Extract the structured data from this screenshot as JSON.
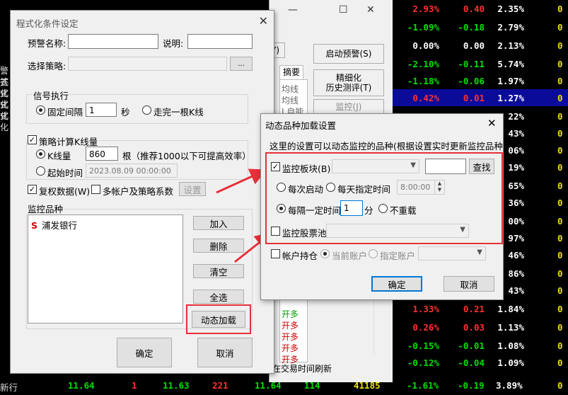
{
  "bg_rows": [
    {
      "c1": "2.93%",
      "c1c": "red",
      "c2": "0.40",
      "c2c": "red",
      "c3": "2.35%",
      "c4": "0"
    },
    {
      "c1": "-1.09%",
      "c1c": "green",
      "c2": "-0.18",
      "c2c": "green",
      "c3": "2.79%",
      "c4": "0"
    },
    {
      "c1": "0.00%",
      "c1c": "white",
      "c2": "0.00",
      "c2c": "white",
      "c3": "2.13%",
      "c4": "0"
    },
    {
      "c1": "-2.10%",
      "c1c": "green",
      "c2": "-0.11",
      "c2c": "green",
      "c3": "5.74%",
      "c4": "0"
    },
    {
      "c1": "-1.18%",
      "c1c": "green",
      "c2": "-0.06",
      "c2c": "green",
      "c3": "1.97%",
      "c4": "0"
    },
    {
      "c1": "0.42%",
      "c1c": "red",
      "c2": "0.01",
      "c2c": "red",
      "c3": "1.27%",
      "c4": "0"
    },
    {
      "c3": "22%",
      "c4": "0"
    },
    {
      "c3": "43%",
      "c4": "0"
    },
    {
      "c3": "06%",
      "c4": "0"
    },
    {
      "c3": "19%",
      "c4": "0"
    },
    {
      "c3": "65%",
      "c4": "0"
    },
    {
      "c3": "36%",
      "c4": "0"
    },
    {
      "c3": "00%",
      "c4": "0"
    },
    {
      "c3": "97%",
      "c4": "0"
    },
    {
      "c3": "46%",
      "c4": "0"
    },
    {
      "c3": "86%",
      "c4": "0"
    },
    {
      "c3": "43%",
      "c4": "0"
    },
    {
      "c1": "1.33%",
      "c1c": "red",
      "c2": "0.21",
      "c2c": "red",
      "c3": "1.84%",
      "c4": "0"
    },
    {
      "c1": "0.26%",
      "c1c": "red",
      "c2": "0.03",
      "c2c": "red",
      "c3": "1.13%",
      "c4": "0"
    },
    {
      "c1": "-0.15%",
      "c1c": "green",
      "c2": "-0.01",
      "c2c": "green",
      "c3": "1.08%",
      "c4": "0"
    },
    {
      "c1": "-0.12%",
      "c1c": "green",
      "c2": "-0.04",
      "c2c": "green",
      "c3": "1.09%",
      "c4": "0"
    }
  ],
  "bottom_bar": {
    "v1": "11.64",
    "v2": "1",
    "v3": "11.63",
    "v4": "221",
    "v5": "11.64",
    "v6": "114",
    "v7": "41185",
    "v8": "-1.61%",
    "v9": "-0.19",
    "v10": "3.89%",
    "v11": "0"
  },
  "left_strip": [
    "警答",
    "式化",
    "式化",
    "式化",
    "式化"
  ],
  "left_strip_bottom": "新行",
  "behind": {
    "btn_y": "Y)",
    "start_alert": "启动预警(S)",
    "refine": "精细化\n历史测评(T)",
    "monitor": "监控(J)",
    "tab_summary": "摘要",
    "list_items": [
      "均线",
      "均线",
      "I,自能"
    ],
    "kai_duo": [
      "开多",
      "开多",
      "开多",
      "开多",
      "开多"
    ],
    "status": "在交易时间刷新"
  },
  "main": {
    "title": "程式化条件设定",
    "close": "✕",
    "alert_name_label": "预警名称:",
    "desc_label": "说明:",
    "strategy_label": "选择策略:",
    "browse": "...",
    "signal_group": "信号执行",
    "fixed_interval": "固定间隔",
    "interval_value": "1",
    "seconds": "秒",
    "finish_kline": "走完一根K线",
    "calc_kline": "策略计算K线量",
    "kline_count_label": "K线量",
    "kline_count": "860",
    "kline_hint": "根（推荐1000以下可提高效率）",
    "start_time_label": "起始时间",
    "start_time": "2023.08.09 00:00:00",
    "restore_data": "复权数据(W)",
    "multi_account": "多帐户及策略系数",
    "settings": "设置",
    "monitor_group": "监控品种",
    "monitored_items": [
      {
        "marker": "S",
        "name": "浦发银行"
      }
    ],
    "add": "加入",
    "delete": "删除",
    "clear": "清空",
    "select_all": "全选",
    "dynamic_load": "动态加载",
    "ok": "确定",
    "cancel": "取消"
  },
  "dialog2": {
    "title": "动态品种加载设置",
    "close": "✕",
    "desc": "这里的设置可以动态监控的品种(根据设置实时更新监控品种)",
    "monitor_sector": "监控板块(B)",
    "search": "查找",
    "every_start": "每次启动",
    "daily_time": "每天指定时间",
    "daily_time_value": "8:00:00",
    "every_interval": "每隔一定时间",
    "interval_value": "1",
    "minutes": "分",
    "no_repeat": "不重载",
    "monitor_pool": "监控股票池",
    "account_position": "帐户持仓",
    "current_account": "当前账户",
    "specified_account": "指定账户",
    "ok": "确定",
    "cancel": "取消"
  },
  "colors": {
    "accent_red": "#e8303a",
    "up": "#ff3030",
    "down": "#00e000",
    "highlight": "#0b0b9a"
  }
}
